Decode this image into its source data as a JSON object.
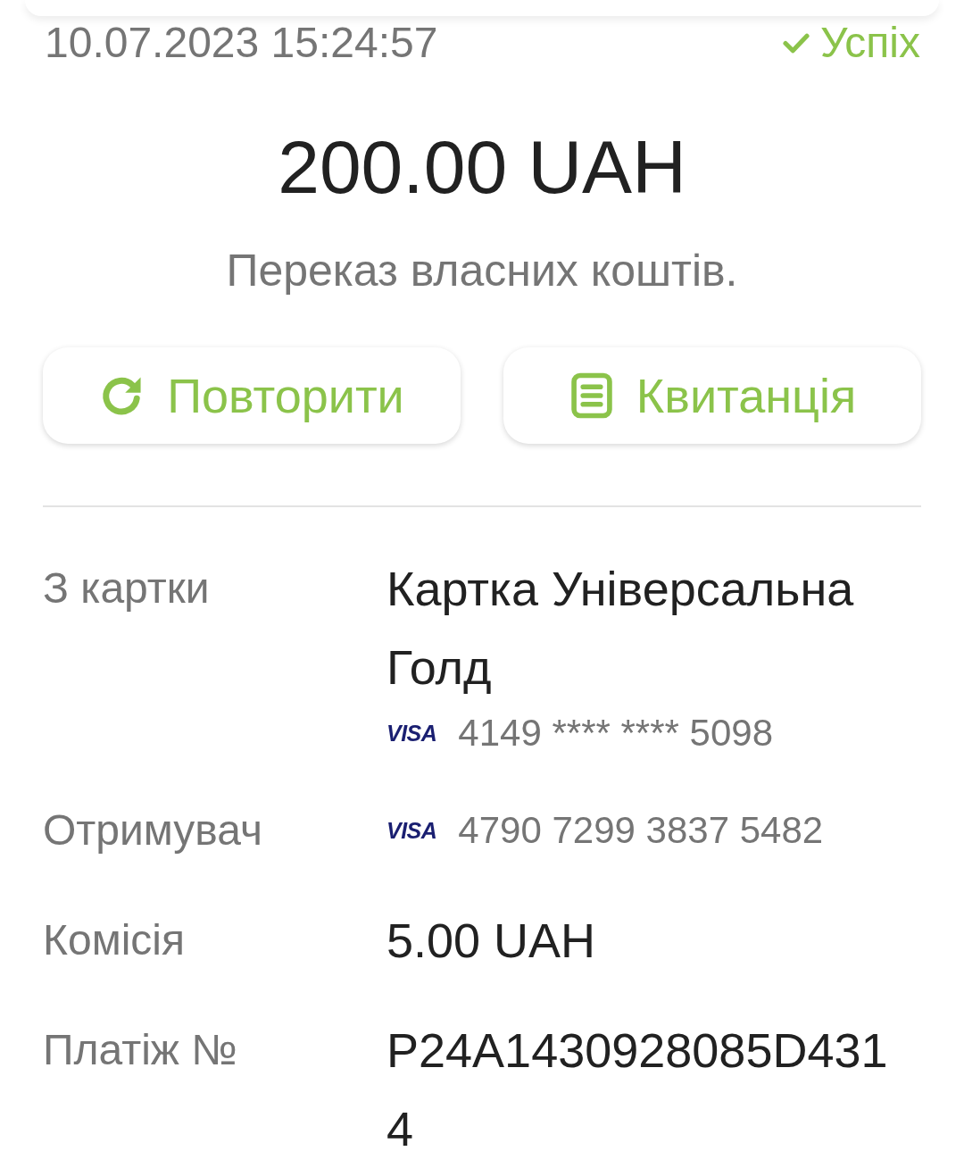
{
  "header": {
    "datetime": "10.07.2023 15:24:57",
    "status": {
      "kind": "success",
      "label": "Успіх"
    }
  },
  "amount": "200.00 UAH",
  "description": "Переказ власних коштів.",
  "actions": [
    {
      "kind": "repeat",
      "label": "Повторити"
    },
    {
      "kind": "receipt",
      "label": "Квитанція"
    }
  ],
  "details": [
    {
      "label": "З картки",
      "value": "Картка Універсальна Голд",
      "card": {
        "brand": "VISA",
        "number": "4149 **** **** 5098"
      }
    },
    {
      "label": "Отримувач",
      "card": {
        "brand": "VISA",
        "number": "4790 7299 3837 5482"
      }
    },
    {
      "label": "Комісія",
      "value": "5.00 UAH"
    },
    {
      "label": "Платіж №",
      "value": "P24A1430928085D4314"
    }
  ]
}
